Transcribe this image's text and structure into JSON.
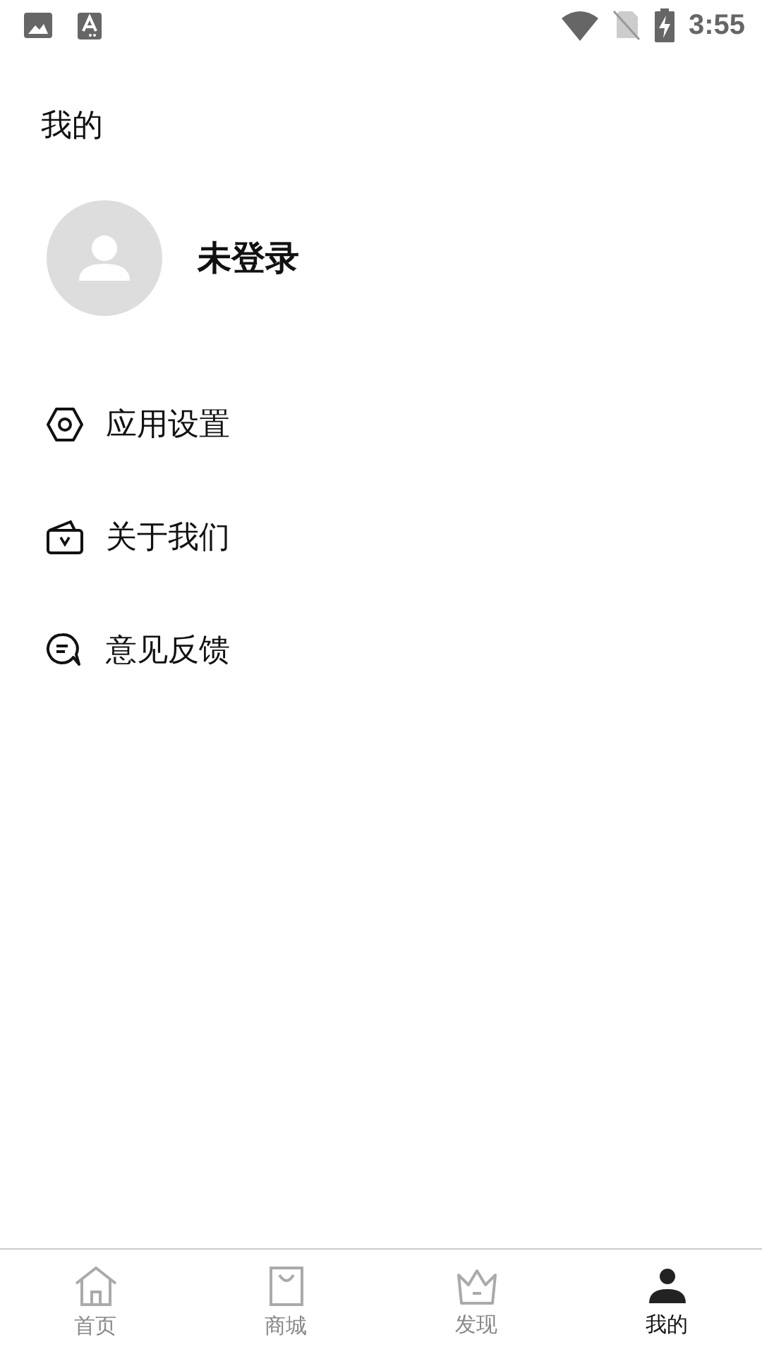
{
  "status_bar": {
    "time": "3:55"
  },
  "title": "我的",
  "profile": {
    "name": "未登录"
  },
  "menu": [
    {
      "kind": "settings",
      "label": "应用设置"
    },
    {
      "kind": "about",
      "label": "关于我们"
    },
    {
      "kind": "feedback",
      "label": "意见反馈"
    }
  ],
  "tabs": [
    {
      "kind": "home",
      "label": "首页",
      "selected": false
    },
    {
      "kind": "shop",
      "label": "商城",
      "selected": false
    },
    {
      "kind": "discover",
      "label": "发现",
      "selected": false
    },
    {
      "kind": "mine",
      "label": "我的",
      "selected": true
    }
  ]
}
